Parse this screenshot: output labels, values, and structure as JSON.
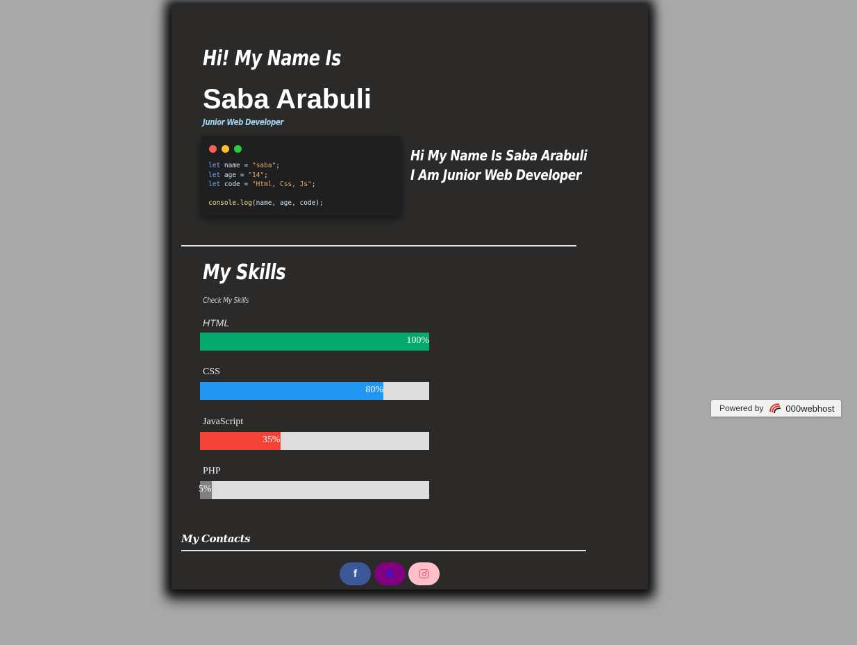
{
  "header": {
    "greeting": "Hi! My Name Is",
    "name": "Saba Arabuli",
    "role": "Junior Web Developer"
  },
  "code_window": {
    "lines": [
      {
        "kw": "let",
        "var": " name = ",
        "str": "\"saba\"",
        "end": ";"
      },
      {
        "kw": "let",
        "var": " age = ",
        "str": "\"14\"",
        "end": ";"
      },
      {
        "kw": "let",
        "var": " code = ",
        "str": "\"Html, Css, Js\"",
        "end": ";"
      }
    ],
    "log_fn": "console.log",
    "log_args": "(name, age, code);"
  },
  "intro": {
    "line1": "Hi My Name Is Saba Arabuli",
    "line2": "I Am Junior Web Developer"
  },
  "skills": {
    "title": "My Skills",
    "subtitle": "Check My Skills",
    "items": [
      {
        "label": "HTML",
        "percent_label": "100%",
        "percent": 100,
        "color": "#04aa6d"
      },
      {
        "label": "CSS",
        "percent_label": "80%",
        "percent": 80,
        "color": "#2196f3"
      },
      {
        "label": "JavaScript",
        "percent_label": "35%",
        "percent": 35,
        "color": "#f44336"
      },
      {
        "label": "PHP",
        "percent_label": "5%",
        "percent": 5,
        "color": "#808080"
      }
    ]
  },
  "contacts": {
    "title": "My Contacts",
    "links": [
      {
        "icon": "facebook-icon",
        "glyph": "f",
        "color": "#3b5998"
      },
      {
        "icon": "google-icon",
        "glyph": "G",
        "color": "#800080"
      },
      {
        "icon": "instagram-icon",
        "color": "#ffc0cb"
      }
    ]
  },
  "badge": {
    "powered_by": "Powered by",
    "host": "000webhost"
  }
}
